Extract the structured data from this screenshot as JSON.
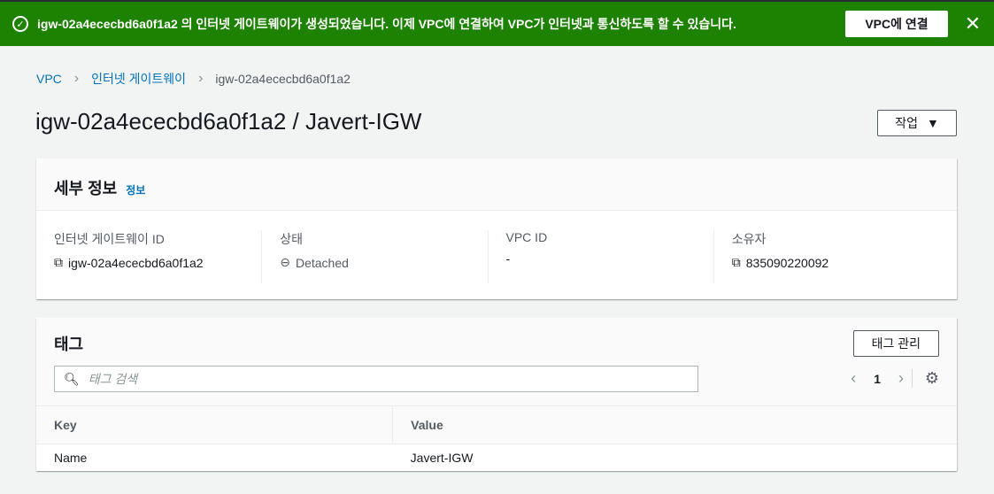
{
  "flash": {
    "message": "igw-02a4ececbd6a0f1a2 의 인터넷 게이트웨이가 생성되었습니다. 이제 VPC에 연결하여 VPC가 인터넷과 통신하도록 할 수 있습니다.",
    "button": "VPC에 연결",
    "close": "✕"
  },
  "breadcrumb": [
    "VPC",
    "인터넷 게이트웨이",
    "igw-02a4ececbd6a0f1a2"
  ],
  "title": "igw-02a4ececbd6a0f1a2 / Javert-IGW",
  "actions": "작업",
  "details": {
    "title": "세부 정보",
    "info": "정보",
    "fields": [
      {
        "label": "인터넷 게이트웨이 ID",
        "value": "igw-02a4ececbd6a0f1a2"
      },
      {
        "label": "상태",
        "value": "Detached"
      },
      {
        "label": "VPC ID",
        "value": "-"
      },
      {
        "label": "소유자",
        "value": "835090220092"
      }
    ]
  },
  "tags": {
    "title": "태그",
    "manage": "태그 관리",
    "search_placeholder": "태그 검색",
    "page": "1",
    "columns": [
      "Key",
      "Value"
    ],
    "rows": [
      [
        "Name",
        "Javert-IGW"
      ]
    ]
  }
}
